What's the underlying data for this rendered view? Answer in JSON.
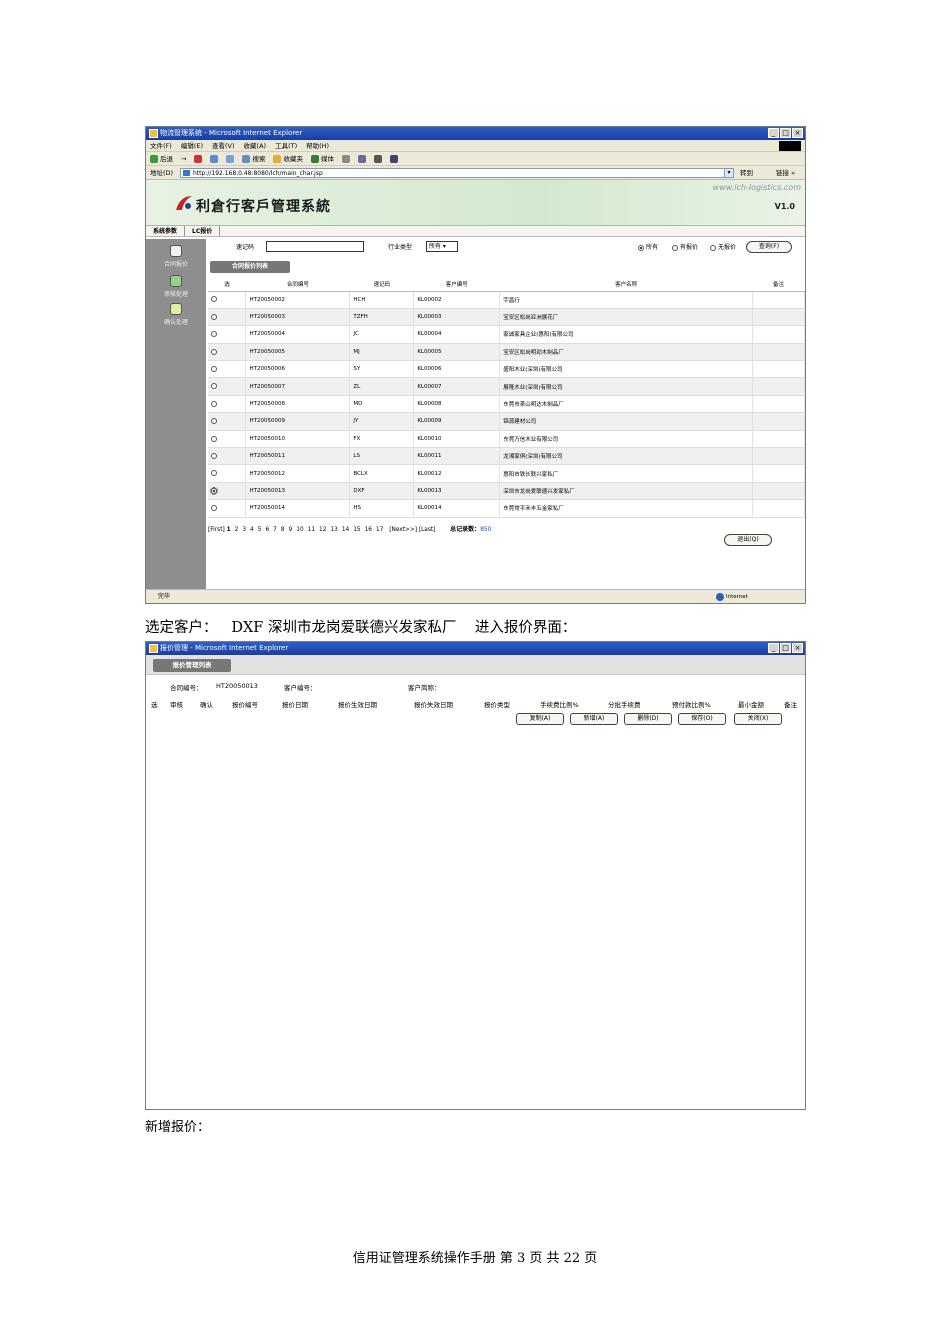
{
  "win1": {
    "title": "物流管理系统 - Microsoft Internet Explorer",
    "menu": [
      "文件(F)",
      "编辑(E)",
      "查看(V)",
      "收藏(A)",
      "工具(T)",
      "帮助(H)"
    ],
    "toolbar": [
      "后退",
      "→",
      "搜索",
      "收藏夹",
      "媒体"
    ],
    "address_label": "地址(D)",
    "address": "http://192.168.0.48:8080/lch/main_char.jsp",
    "go": "转到",
    "links": "链接 »",
    "site_url": "www.lch-logistics.com",
    "system_name": "利倉行客戶管理系統",
    "version": "V1.0",
    "tabs": [
      "系统参数",
      "LC报价"
    ],
    "left_nav": [
      "合同报价",
      "审核处理",
      "确认处理"
    ],
    "filter": {
      "code_label": "速记码",
      "industry_label": "行业类型",
      "industry_value": "所有",
      "radio_all": "所有",
      "radio_quoted": "有报价",
      "radio_unquoted": "无报价",
      "query_button": "查询(F)"
    },
    "section_title": "合同报价列表",
    "columns": [
      "选",
      "合同编号",
      "速记码",
      "客户编号",
      "客户名称",
      "备注"
    ],
    "rows": [
      [
        "HT20050002",
        "HCH",
        "KL00002",
        "宇昌行",
        ""
      ],
      [
        "HT20050003",
        "TZFH",
        "KL00003",
        "宝安区松岗亚洲展花厂",
        ""
      ],
      [
        "HT20050004",
        "JC",
        "KL00004",
        "家诚家具企业(惠阳)有限公司",
        ""
      ],
      [
        "HT20050005",
        "MJ",
        "KL00005",
        "宝安区松岗明劲木制品厂",
        ""
      ],
      [
        "HT20050006",
        "SY",
        "KL00006",
        "盛阳木业(深圳)有限公司",
        ""
      ],
      [
        "HT20050007",
        "ZL",
        "KL00007",
        "展隆木业(深圳)有限公司",
        ""
      ],
      [
        "HT20050008",
        "MD",
        "KL00008",
        "东莞市茶山明达木制品厂",
        ""
      ],
      [
        "HT20050009",
        "JY",
        "KL00009",
        "锦源建材公司",
        ""
      ],
      [
        "HT20050010",
        "FX",
        "KL00010",
        "东莞万信木业有限公司",
        ""
      ],
      [
        "HT20050011",
        "LS",
        "KL00011",
        "龙湘家俱(深圳)有限公司",
        ""
      ],
      [
        "HT20050012",
        "BCLX",
        "KL00012",
        "惠阳市铁长联兴家私厂",
        ""
      ],
      [
        "HT20050013",
        "DXF",
        "KL00013",
        "深圳市龙岗爱联德兴发家私厂",
        ""
      ],
      [
        "HT20050014",
        "HS",
        "KL00014",
        "东莞常平禾丰五金家私厂",
        ""
      ]
    ],
    "selected_row": 11,
    "pager": {
      "first": "[First]",
      "pages": [
        "1",
        "2",
        "3",
        "4",
        "5",
        "6",
        "7",
        "8",
        "9",
        "10",
        "11",
        "12",
        "13",
        "14",
        "15",
        "16",
        "17"
      ],
      "next": "[Next>>]",
      "last": "[Last]",
      "total_label": "总记录数：",
      "total": "850"
    },
    "exit_button": "退出(Q)",
    "status": "完毕",
    "zone": "Internet"
  },
  "caption": {
    "prefix": "选定客户：",
    "customer": "DXF  深圳市龙岗爱联德兴发家私厂",
    "suffix": "进入报价界面："
  },
  "win2": {
    "title": "报价管理 - Microsoft Internet Explorer",
    "section_title": "报价管理列表",
    "contract_label": "合同编号：",
    "contract_no": "HT20050013",
    "customer_no_label": "客户编号：",
    "customer_abbr_label": "客户简称：",
    "columns": [
      "选",
      "审核",
      "确认",
      "报价编号",
      "报价日期",
      "报价生效日期",
      "报价失效日期",
      "报价类型",
      "手续费比例%",
      "分批手续费",
      "预付款比例%",
      "最小金额",
      "备注"
    ],
    "buttons": [
      "复制(A)",
      "新增(A)",
      "删除(D)",
      "保存(O)",
      "关闭(X)"
    ]
  },
  "footnote": "新增报价：",
  "footer": "信用证管理系统操作手册 第 3 页 共 22 页"
}
